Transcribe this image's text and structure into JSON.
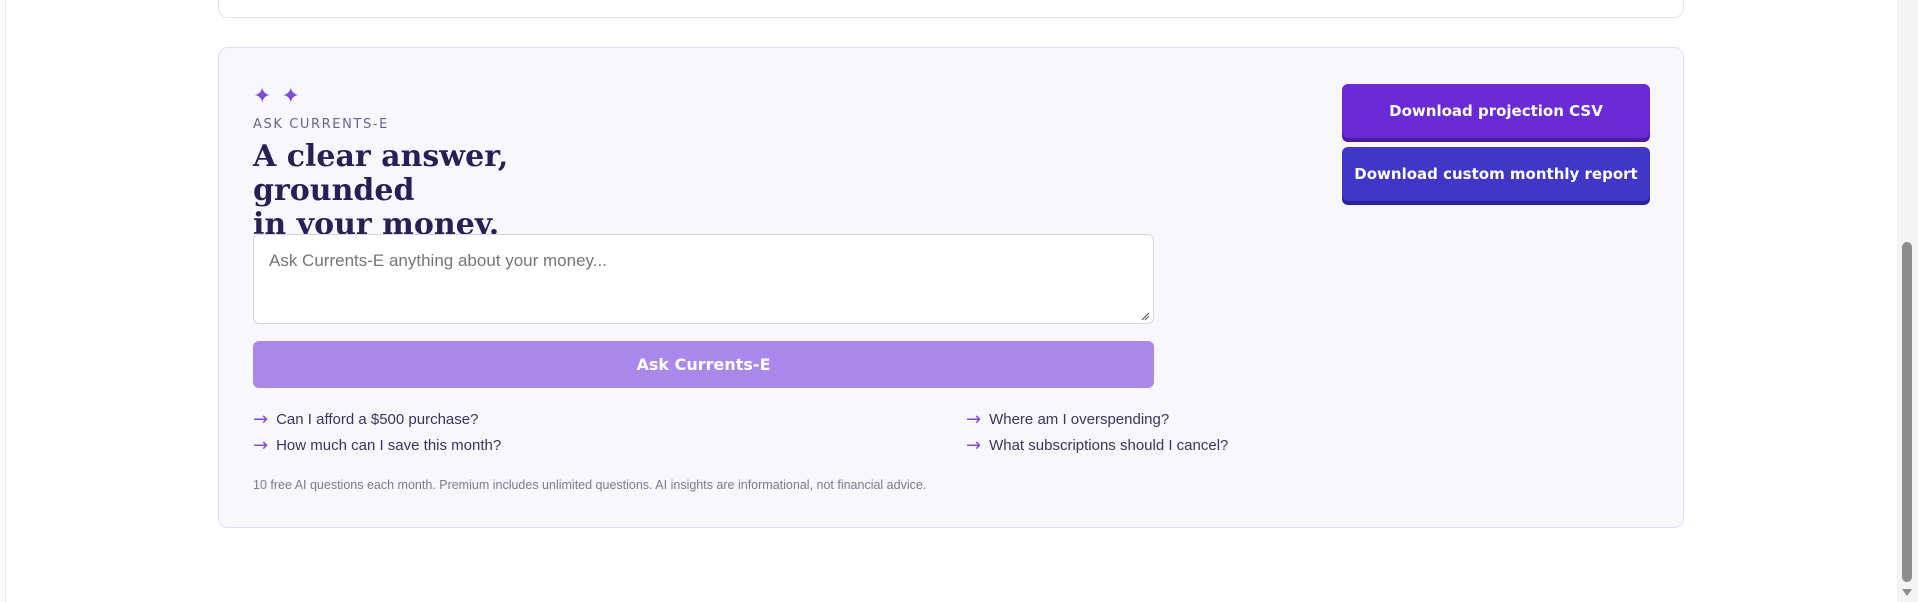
{
  "ask": {
    "icon": "sparkles-icon",
    "eyebrow": "ASK CURRENTS-E",
    "headline_line1": "A clear answer, grounded",
    "headline_line2": "in your money.",
    "input_placeholder": "Ask Currents-E anything about your money...",
    "submit_label": "Ask Currents-E",
    "suggestions": [
      "Can I afford a $500 purchase?",
      "Where am I overspending?",
      "How much can I save this month?",
      "What subscriptions should I cancel?"
    ],
    "disclaimer": "10 free AI questions each month. Premium includes unlimited questions. AI insights are informational, not financial advice."
  },
  "actions": {
    "download_csv_label": "Download projection CSV",
    "download_report_label": "Download custom monthly report"
  },
  "colors": {
    "accent": "#6a2ad6",
    "secondary": "#4036c8",
    "ask_button": "#aa87ea",
    "panel_bg": "#f8f7fe"
  }
}
